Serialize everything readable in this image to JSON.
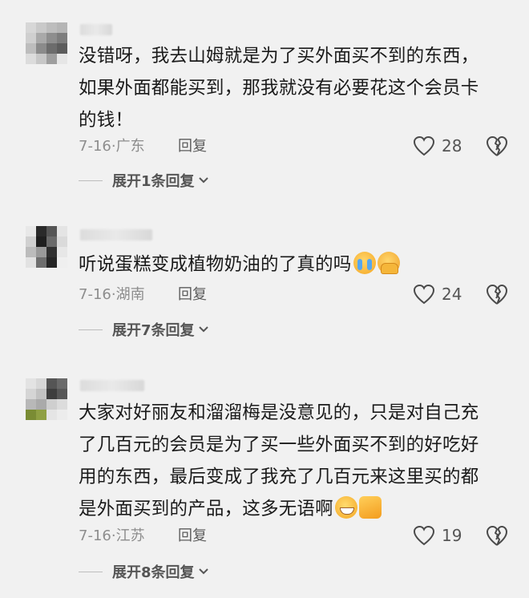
{
  "comments": [
    {
      "text_lines": [
        "没错呀，我去山姆就是为了买外面买不到的东西，",
        "如果外面都能买到，那我就没有必要花这个会员卡",
        "的钱！"
      ],
      "date": "7-16",
      "location": "广东",
      "reply_label": "回复",
      "likes": "28",
      "expand_label": "展开1条回复"
    },
    {
      "text_lines": [
        "听说蛋糕变成植物奶油的了真的吗"
      ],
      "emojis": [
        "loudly-crying-face",
        "pleading-face"
      ],
      "date": "7-16",
      "location": "湖南",
      "reply_label": "回复",
      "likes": "24",
      "expand_label": "展开7条回复"
    },
    {
      "text_lines": [
        "大家对好丽友和溜溜梅是没意见的，只是对自己充",
        "了几百元的会员是为了买一些外面买不到的好吃好",
        "用的东西，最后变成了我充了几百元来这里买的都",
        "是外面买到的产品，这多无语啊"
      ],
      "emojis": [
        "grinning-sweat-face",
        "thumbs-up"
      ],
      "date": "7-16",
      "location": "江苏",
      "reply_label": "回复",
      "likes": "19",
      "expand_label": "展开8条回复"
    }
  ],
  "separator": "·",
  "colors": {
    "background": "#f1f1f1",
    "text": "#1a1a1a",
    "meta": "#8d8d8d"
  }
}
